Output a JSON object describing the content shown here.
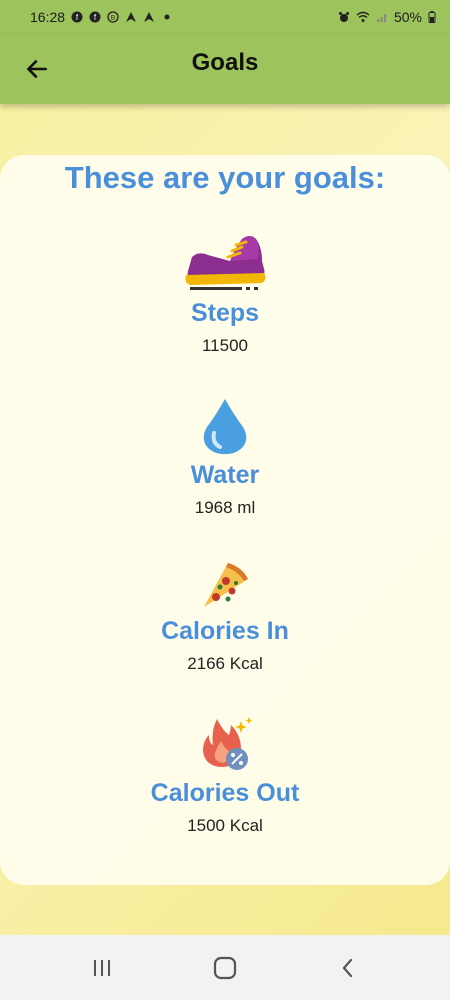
{
  "status_bar": {
    "time": "16:28",
    "battery": "50%"
  },
  "header": {
    "title": "Goals"
  },
  "main": {
    "heading": "These are your goals:",
    "goals": [
      {
        "name": "Steps",
        "value": "11500",
        "icon": "sneaker-icon"
      },
      {
        "name": "Water",
        "value": "1968 ml",
        "icon": "water-drop-icon"
      },
      {
        "name": "Calories In",
        "value": "2166 Kcal",
        "icon": "pizza-icon"
      },
      {
        "name": "Calories Out",
        "value": "1500 Kcal",
        "icon": "fire-icon"
      }
    ]
  },
  "nav": {
    "items": [
      "recent-apps-icon",
      "home-icon",
      "back-icon"
    ]
  },
  "colors": {
    "app_bar": "#9dc35d",
    "accent": "#4a8fd9",
    "background": "#f7ef9c"
  }
}
